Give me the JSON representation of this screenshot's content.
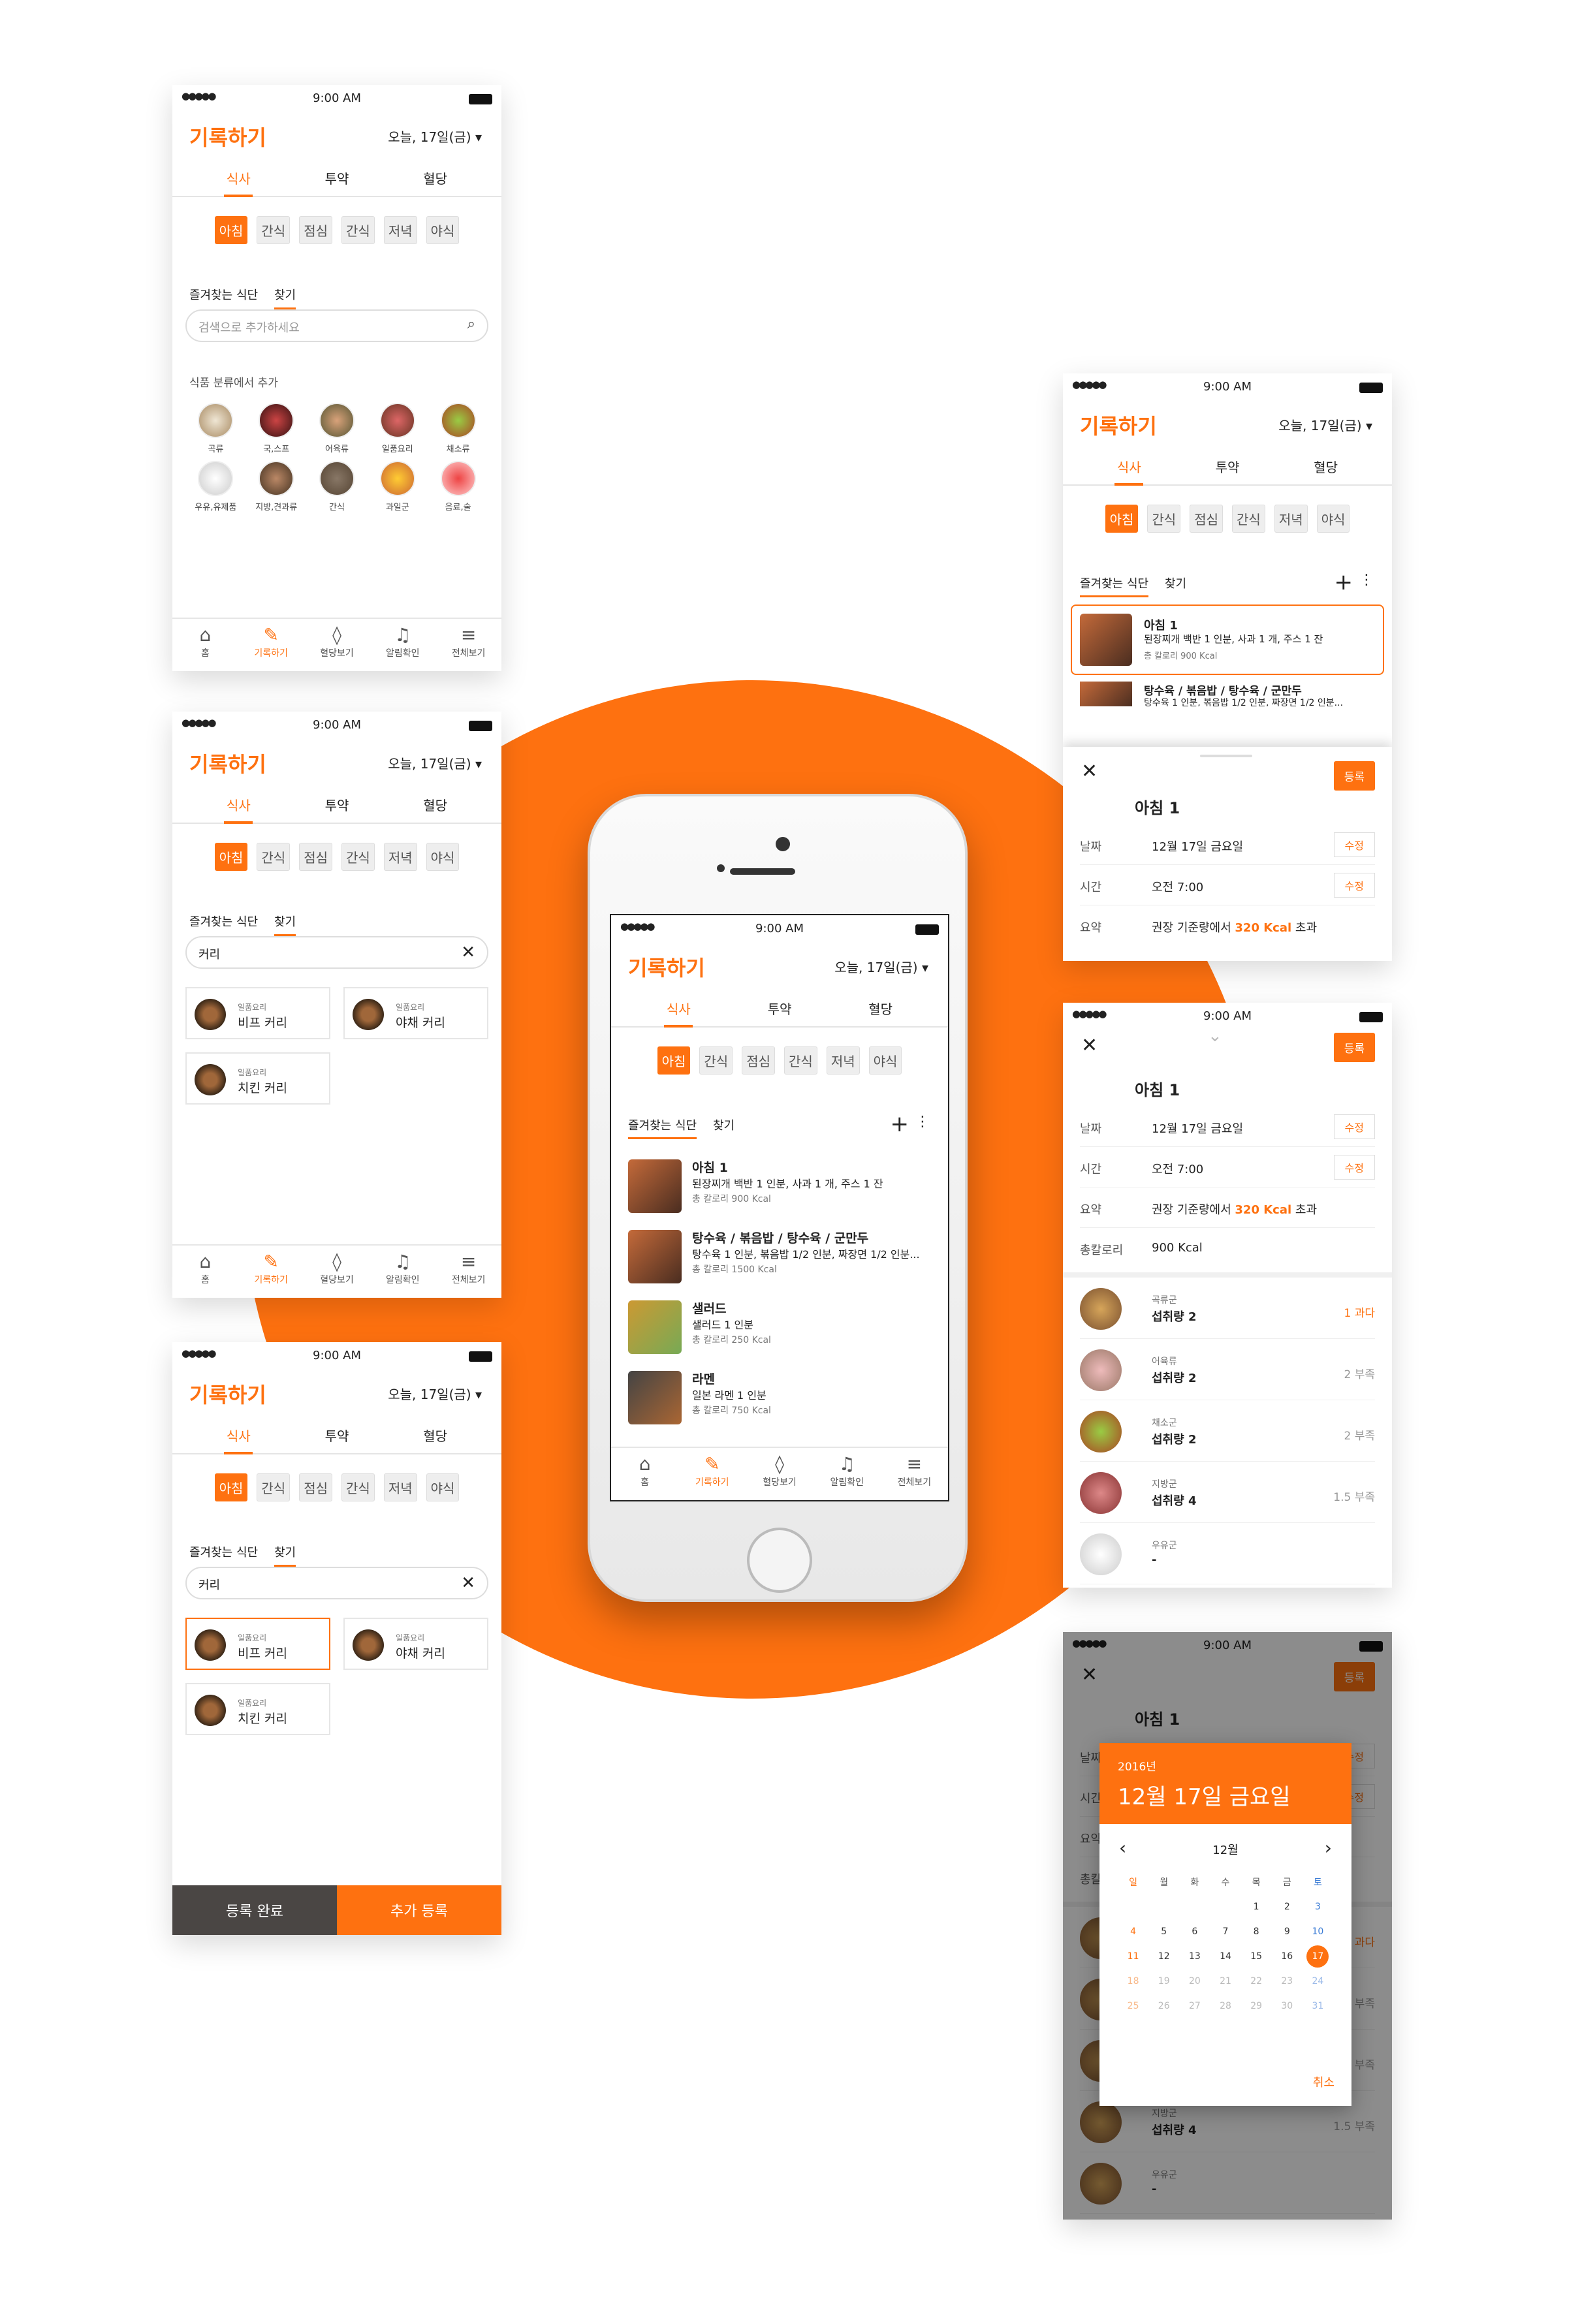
{
  "brand_color": "#fe7110",
  "status": {
    "time": "9:00 AM"
  },
  "header": {
    "title": "기록하기",
    "date": "오늘, 17일(금) ▾"
  },
  "tabs": [
    "식사",
    "투약",
    "혈당"
  ],
  "meals": [
    "아침",
    "간식",
    "점심",
    "간식",
    "저녁",
    "야식"
  ],
  "subtabs": {
    "fav": "즐겨찾는 식단",
    "find": "찾기"
  },
  "search": {
    "placeholder": "검색으로 추가하세요",
    "query": "커리"
  },
  "category_title": "식품 분류에서 추가",
  "categories": [
    "곡류",
    "국,스프",
    "어육류",
    "일품요리",
    "채소류",
    "우유,유제품",
    "지방,견과류",
    "간식",
    "과일군",
    "음료,술"
  ],
  "nav": [
    {
      "icon": "⌂",
      "label": "홈"
    },
    {
      "icon": "✎",
      "label": "기록하기"
    },
    {
      "icon": "◊",
      "label": "혈당보기"
    },
    {
      "icon": "♫",
      "label": "알림확인"
    },
    {
      "icon": "≡",
      "label": "전체보기"
    }
  ],
  "curry": {
    "group": "일품요리",
    "items": [
      "비프 커리",
      "야채 커리",
      "치킨 커리"
    ]
  },
  "footer": {
    "done": "등록 완료",
    "add": "추가 등록"
  },
  "favorites": [
    {
      "name": "아침 1",
      "desc": "된장찌개 백반 1 인분, 사과 1 개, 주스 1 잔",
      "kcal": "총 칼로리 900 Kcal"
    },
    {
      "name": "탕수육 / 볶음밥 / 탕수육 / 군만두",
      "desc": "탕수육 1 인분, 볶음밥 1/2 인분, 짜장면 1/2 인분...",
      "kcal": "총 칼로리 1500 Kcal"
    },
    {
      "name": "샐러드",
      "desc": "샐러드 1 인분",
      "kcal": "총 칼로리 250 Kcal"
    },
    {
      "name": "라멘",
      "desc": "일본 라멘 1 인분",
      "kcal": "총 칼로리 750 Kcal"
    }
  ],
  "detail": {
    "register": "등록",
    "name": "아침 1",
    "date_label": "날짜",
    "date": "12월 17일 금요일",
    "time_label": "시간",
    "time": "오전 7:00",
    "edit": "수정",
    "summary_label": "요약",
    "summary_pre": "권장 기준량에서",
    "summary_val": "320 Kcal",
    "summary_post": "초과",
    "total_label": "총칼로리",
    "total": "900 Kcal"
  },
  "nutrition": [
    {
      "group": "곡류군",
      "name": "섭취량 2",
      "status": "1 과다"
    },
    {
      "group": "어육류",
      "name": "섭취량 2",
      "status": "2 부족"
    },
    {
      "group": "채소군",
      "name": "섭취량 2",
      "status": "2 부족"
    },
    {
      "group": "지방군",
      "name": "섭취량 4",
      "status": "1.5 부족"
    },
    {
      "group": "우유군",
      "name": "-",
      "status": ""
    }
  ],
  "calendar": {
    "year": "2016년",
    "date": "12월 17일 금요일",
    "month": "12월",
    "weekdays": [
      "일",
      "월",
      "화",
      "수",
      "목",
      "금",
      "토"
    ],
    "weeks": [
      [
        "",
        "",
        "",
        "",
        "1",
        "2",
        "3"
      ],
      [
        "4",
        "5",
        "6",
        "7",
        "8",
        "9",
        "10"
      ],
      [
        "11",
        "12",
        "13",
        "14",
        "15",
        "16",
        "17"
      ],
      [
        "18",
        "19",
        "20",
        "21",
        "22",
        "23",
        "24"
      ],
      [
        "25",
        "26",
        "27",
        "28",
        "29",
        "30",
        "31"
      ]
    ],
    "cancel": "취소"
  }
}
